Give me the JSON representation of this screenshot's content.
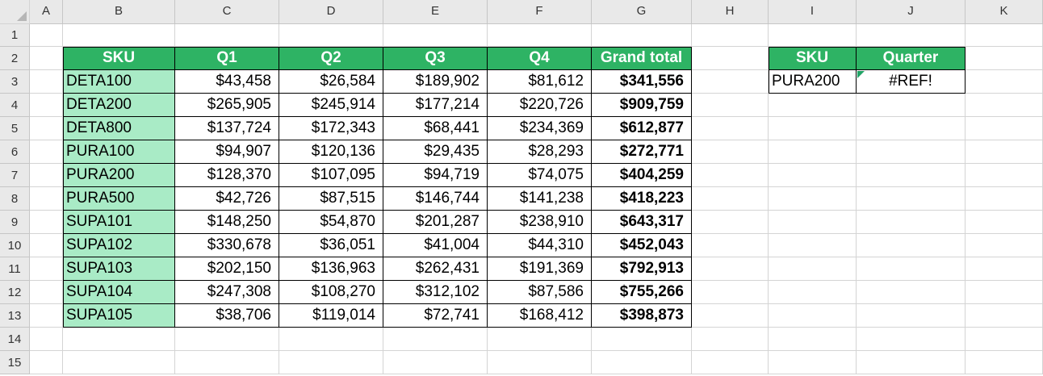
{
  "sheet": {
    "columns": [
      "A",
      "B",
      "C",
      "D",
      "E",
      "F",
      "G",
      "H",
      "I",
      "J",
      "K"
    ],
    "rows": [
      "1",
      "2",
      "3",
      "4",
      "5",
      "6",
      "7",
      "8",
      "9",
      "10",
      "11",
      "12",
      "13",
      "14",
      "15"
    ]
  },
  "colors": {
    "header_green": "#2eb364",
    "sku_fill": "#a9ebc6"
  },
  "sales_table": {
    "headers": [
      "SKU",
      "Q1",
      "Q2",
      "Q3",
      "Q4",
      "Grand total"
    ],
    "rows": [
      [
        "DETA100",
        "$43,458",
        "$26,584",
        "$189,902",
        "$81,612",
        "$341,556"
      ],
      [
        "DETA200",
        "$265,905",
        "$245,914",
        "$177,214",
        "$220,726",
        "$909,759"
      ],
      [
        "DETA800",
        "$137,724",
        "$172,343",
        "$68,441",
        "$234,369",
        "$612,877"
      ],
      [
        "PURA100",
        "$94,907",
        "$120,136",
        "$29,435",
        "$28,293",
        "$272,771"
      ],
      [
        "PURA200",
        "$128,370",
        "$107,095",
        "$94,719",
        "$74,075",
        "$404,259"
      ],
      [
        "PURA500",
        "$42,726",
        "$87,515",
        "$146,744",
        "$141,238",
        "$418,223"
      ],
      [
        "SUPA101",
        "$148,250",
        "$54,870",
        "$201,287",
        "$238,910",
        "$643,317"
      ],
      [
        "SUPA102",
        "$330,678",
        "$36,051",
        "$41,004",
        "$44,310",
        "$452,043"
      ],
      [
        "SUPA103",
        "$202,150",
        "$136,963",
        "$262,431",
        "$191,369",
        "$792,913"
      ],
      [
        "SUPA104",
        "$247,308",
        "$108,270",
        "$312,102",
        "$87,586",
        "$755,266"
      ],
      [
        "SUPA105",
        "$38,706",
        "$119,014",
        "$72,741",
        "$168,412",
        "$398,873"
      ]
    ]
  },
  "lookup_table": {
    "headers": [
      "SKU",
      "Quarter"
    ],
    "values": [
      "PURA200",
      "#REF!"
    ]
  }
}
